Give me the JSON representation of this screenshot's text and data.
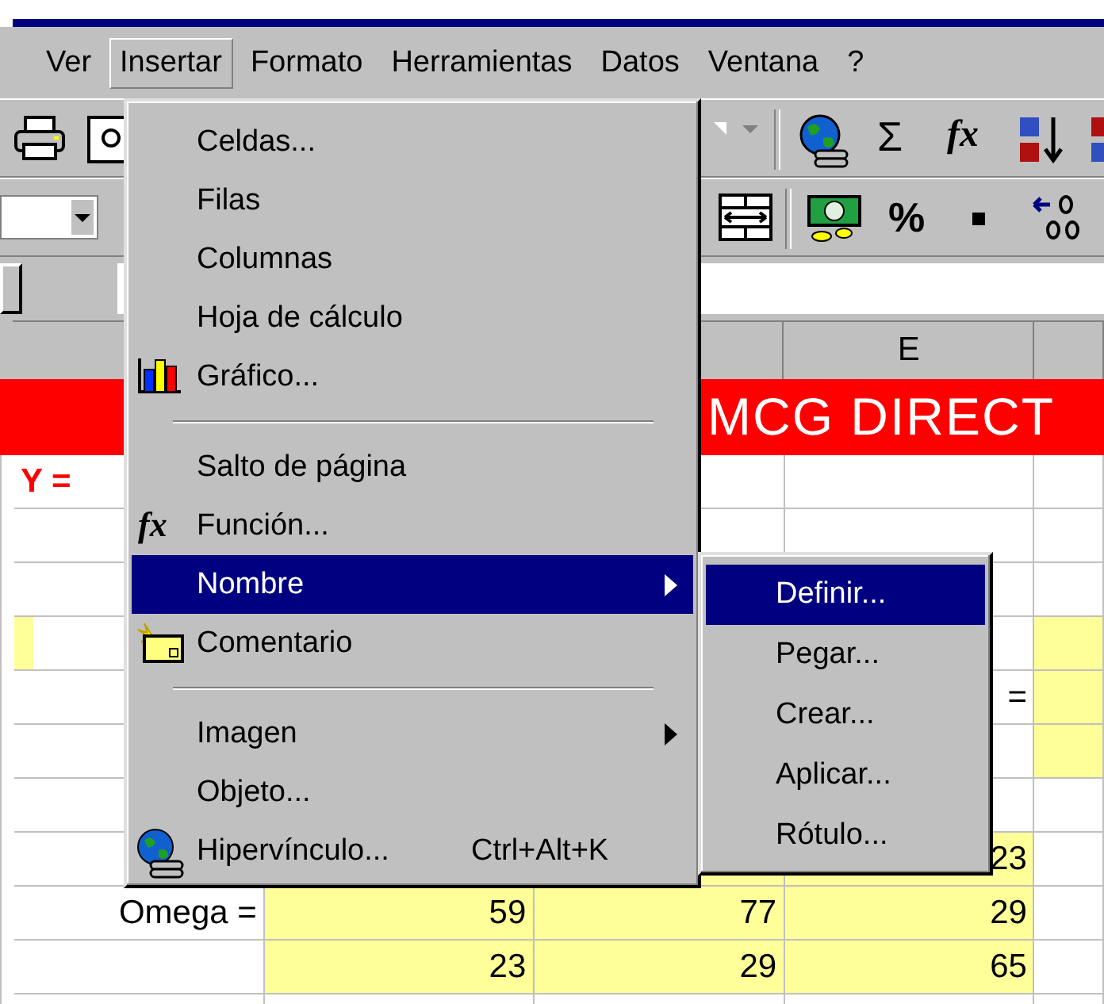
{
  "menu_bar": [
    {
      "label": "Ver",
      "selected": false
    },
    {
      "label": "Insertar",
      "selected": true
    },
    {
      "label": "Formato",
      "selected": false
    },
    {
      "label": "Herramientas",
      "selected": false
    },
    {
      "label": "Datos",
      "selected": false
    },
    {
      "label": "Ventana",
      "selected": false
    },
    {
      "label": "?",
      "selected": false
    }
  ],
  "toolbar": {
    "sum": "Σ",
    "function": "fx",
    "percent": "%"
  },
  "column_header": "E",
  "rows": [
    {
      "kind": "title",
      "text": "MCG DIRECT"
    },
    {
      "kind": "formula",
      "text": "Y ="
    },
    {
      "kind": "blank"
    },
    {
      "kind": "blank"
    },
    {
      "kind": "highlight"
    },
    {
      "kind": "highlight",
      "text": "="
    },
    {
      "kind": "highlight"
    },
    {
      "kind": "blank"
    },
    {
      "kind": "data",
      "values": [
        "23"
      ]
    },
    {
      "kind": "data",
      "text": "Omega =",
      "values": [
        "59",
        "77",
        "29"
      ]
    },
    {
      "kind": "data",
      "values": [
        "23",
        "29",
        "65"
      ]
    },
    {
      "kind": "blank"
    }
  ],
  "insert_menu": [
    {
      "kind": "item",
      "label": "Celdas...",
      "has_submenu": false,
      "selected": false
    },
    {
      "kind": "item",
      "label": "Filas",
      "has_submenu": false,
      "selected": false
    },
    {
      "kind": "item",
      "label": "Columnas",
      "has_submenu": false,
      "selected": false
    },
    {
      "kind": "item",
      "label": "Hoja de cálculo",
      "has_submenu": false,
      "selected": false
    },
    {
      "kind": "item",
      "label": "Gráfico...",
      "has_submenu": false,
      "selected": false
    },
    {
      "kind": "separator"
    },
    {
      "kind": "item",
      "label": "Salto de página",
      "has_submenu": false,
      "selected": false
    },
    {
      "kind": "item",
      "label": "Función...",
      "icon_text": "fx",
      "has_submenu": false,
      "selected": false
    },
    {
      "kind": "item",
      "label": "Nombre",
      "has_submenu": true,
      "selected": true
    },
    {
      "kind": "item",
      "label": "Comentario",
      "has_submenu": false,
      "selected": false
    },
    {
      "kind": "separator"
    },
    {
      "kind": "item",
      "label": "Imagen",
      "has_submenu": true,
      "selected": false
    },
    {
      "kind": "item",
      "label": "Objeto...",
      "has_submenu": false,
      "selected": false
    },
    {
      "kind": "item",
      "label": "Hipervínculo...",
      "shortcut": "Ctrl+Alt+K",
      "has_submenu": false,
      "selected": false
    }
  ],
  "name_submenu": [
    {
      "label": "Definir...",
      "selected": true
    },
    {
      "label": "Pegar...",
      "selected": false
    },
    {
      "label": "Crear...",
      "selected": false
    },
    {
      "label": "Aplicar...",
      "selected": false
    },
    {
      "label": "Rótulo...",
      "selected": false
    }
  ]
}
